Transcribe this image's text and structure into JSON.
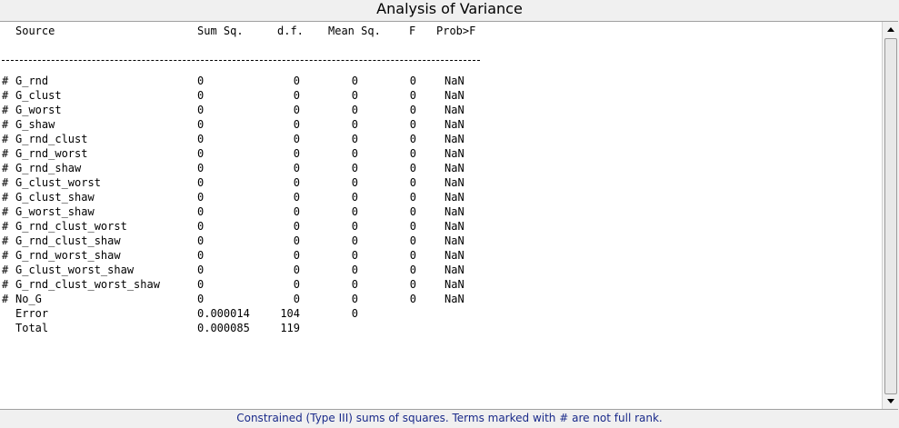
{
  "window": {
    "title": "Analysis of Variance"
  },
  "table": {
    "headers": {
      "source": "Source",
      "sum_sq": "Sum Sq.",
      "df": "d.f.",
      "mean_sq": "Mean Sq.",
      "f": "F",
      "prob": "Prob>F"
    },
    "rows": [
      {
        "mark": "#",
        "source": "G_rnd",
        "sum_sq": "0",
        "df": "0",
        "mean_sq": "0",
        "f": "0",
        "prob": "NaN"
      },
      {
        "mark": "#",
        "source": "G_clust",
        "sum_sq": "0",
        "df": "0",
        "mean_sq": "0",
        "f": "0",
        "prob": "NaN"
      },
      {
        "mark": "#",
        "source": "G_worst",
        "sum_sq": "0",
        "df": "0",
        "mean_sq": "0",
        "f": "0",
        "prob": "NaN"
      },
      {
        "mark": "#",
        "source": "G_shaw",
        "sum_sq": "0",
        "df": "0",
        "mean_sq": "0",
        "f": "0",
        "prob": "NaN"
      },
      {
        "mark": "#",
        "source": "G_rnd_clust",
        "sum_sq": "0",
        "df": "0",
        "mean_sq": "0",
        "f": "0",
        "prob": "NaN"
      },
      {
        "mark": "#",
        "source": "G_rnd_worst",
        "sum_sq": "0",
        "df": "0",
        "mean_sq": "0",
        "f": "0",
        "prob": "NaN"
      },
      {
        "mark": "#",
        "source": "G_rnd_shaw",
        "sum_sq": "0",
        "df": "0",
        "mean_sq": "0",
        "f": "0",
        "prob": "NaN"
      },
      {
        "mark": "#",
        "source": "G_clust_worst",
        "sum_sq": "0",
        "df": "0",
        "mean_sq": "0",
        "f": "0",
        "prob": "NaN"
      },
      {
        "mark": "#",
        "source": "G_clust_shaw",
        "sum_sq": "0",
        "df": "0",
        "mean_sq": "0",
        "f": "0",
        "prob": "NaN"
      },
      {
        "mark": "#",
        "source": "G_worst_shaw",
        "sum_sq": "0",
        "df": "0",
        "mean_sq": "0",
        "f": "0",
        "prob": "NaN"
      },
      {
        "mark": "#",
        "source": "G_rnd_clust_worst",
        "sum_sq": "0",
        "df": "0",
        "mean_sq": "0",
        "f": "0",
        "prob": "NaN"
      },
      {
        "mark": "#",
        "source": "G_rnd_clust_shaw",
        "sum_sq": "0",
        "df": "0",
        "mean_sq": "0",
        "f": "0",
        "prob": "NaN"
      },
      {
        "mark": "#",
        "source": "G_rnd_worst_shaw",
        "sum_sq": "0",
        "df": "0",
        "mean_sq": "0",
        "f": "0",
        "prob": "NaN"
      },
      {
        "mark": "#",
        "source": "G_clust_worst_shaw",
        "sum_sq": "0",
        "df": "0",
        "mean_sq": "0",
        "f": "0",
        "prob": "NaN"
      },
      {
        "mark": "#",
        "source": "G_rnd_clust_worst_shaw",
        "sum_sq": "0",
        "df": "0",
        "mean_sq": "0",
        "f": "0",
        "prob": "NaN"
      },
      {
        "mark": "#",
        "source": "No_G",
        "sum_sq": "0",
        "df": "0",
        "mean_sq": "0",
        "f": "0",
        "prob": "NaN"
      },
      {
        "mark": "",
        "source": "Error",
        "sum_sq": "0.000014",
        "df": "104",
        "mean_sq": "0",
        "f": "",
        "prob": ""
      },
      {
        "mark": "",
        "source": "Total",
        "sum_sq": "0.000085",
        "df": "119",
        "mean_sq": "",
        "f": "",
        "prob": ""
      }
    ]
  },
  "footnote": "Constrained (Type III) sums of squares.  Terms marked with # are not full rank.",
  "colors": {
    "footnote_text": "#1a2a8a",
    "background": "#f0f0f0",
    "panel": "#ffffff"
  },
  "icons": {
    "scroll_up": "arrow-up-icon",
    "scroll_down": "arrow-down-icon"
  }
}
